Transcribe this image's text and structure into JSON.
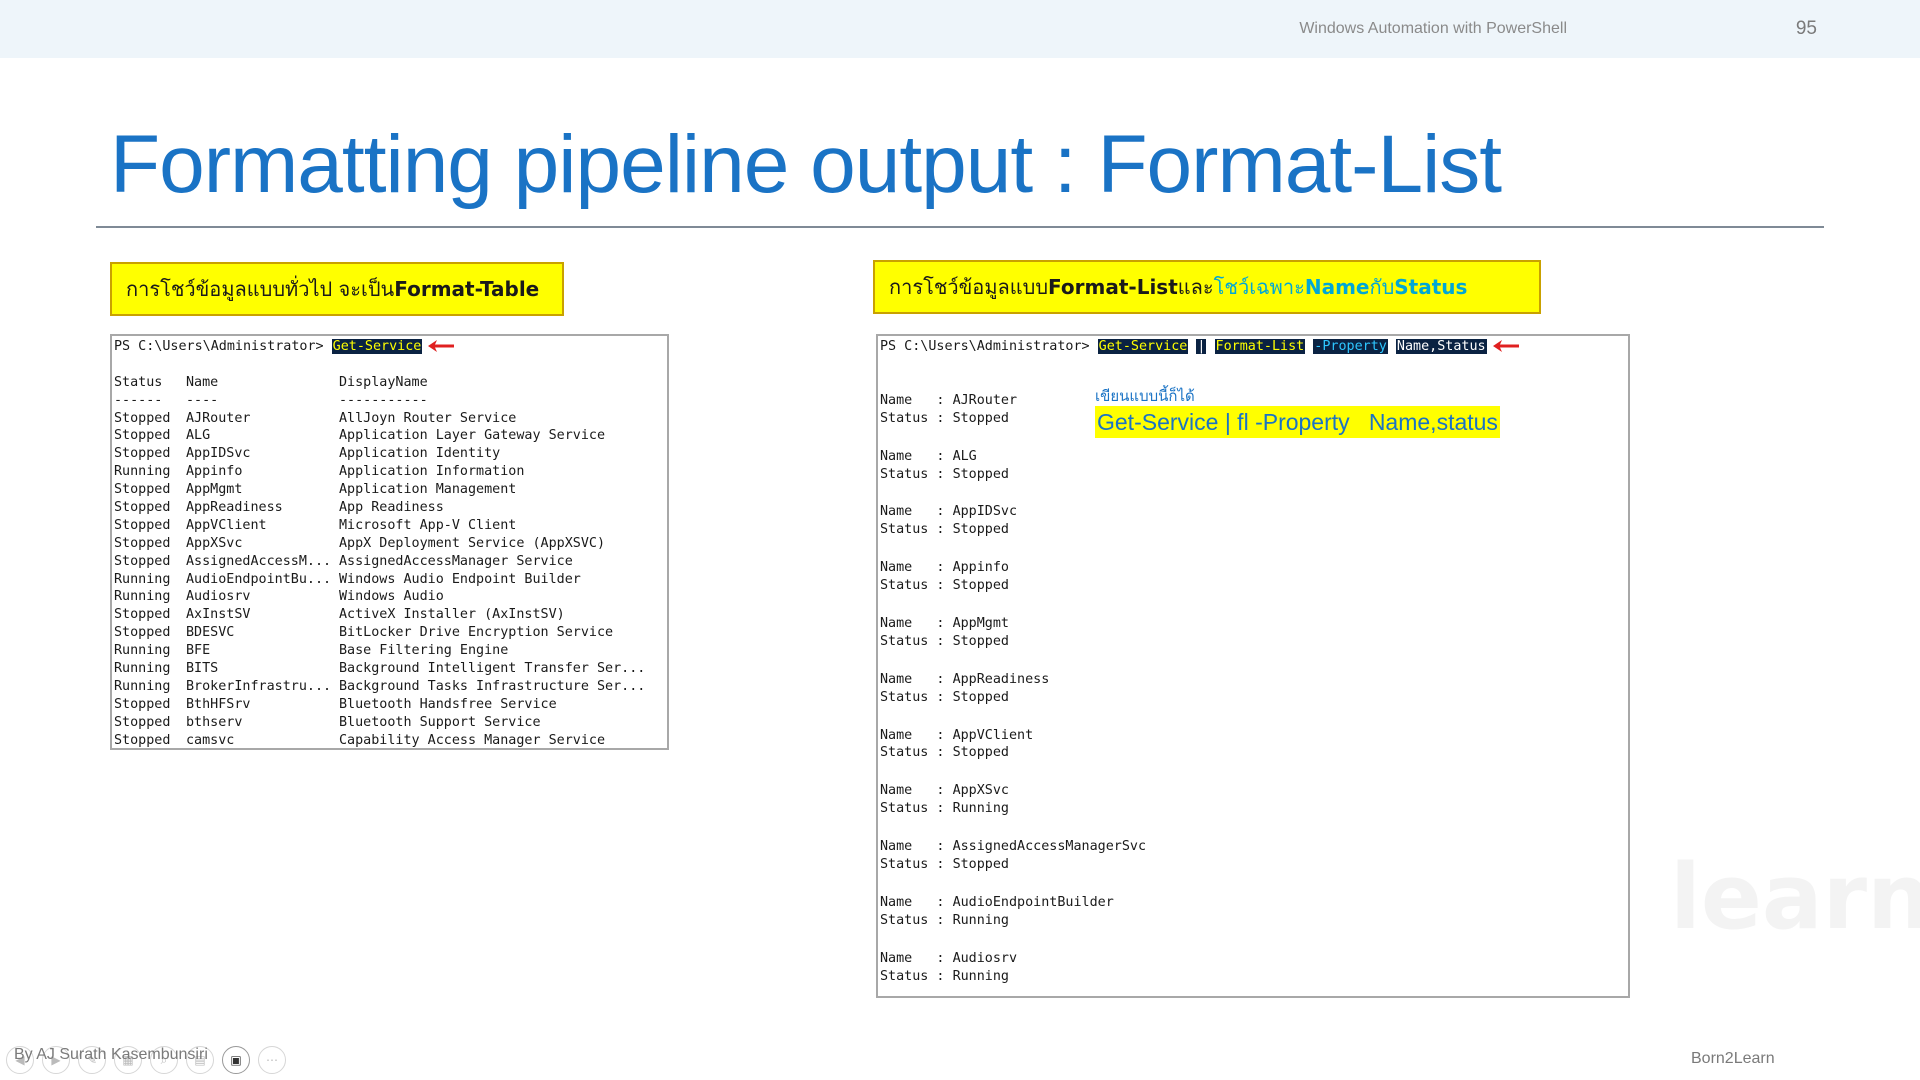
{
  "header": {
    "deck_title": "Windows Automation with PowerShell",
    "page_number": "95"
  },
  "slide": {
    "title": "Formatting pipeline output : Format-List"
  },
  "note_left": {
    "text_thai": "การโชว์ข้อมูลแบบทั่วไป จะเป็น ",
    "text_bold": "Format-Table"
  },
  "note_right": {
    "text_thai": "การโชว์ข้อมูลแบบ ",
    "text_bold": "Format-List",
    "text_mid": " และ",
    "text_cyan": "โชว์เฉพาะ ",
    "text_cyan_bold1": "Name",
    "text_cyan_mid": " กับ ",
    "text_cyan_bold2": "Status"
  },
  "console_left": {
    "prompt": "PS C:\\Users\\Administrator> ",
    "command": "Get-Service",
    "headers": [
      "Status",
      "Name",
      "DisplayName"
    ],
    "underlines": [
      "------",
      "----",
      "-----------"
    ],
    "rows": [
      [
        "Stopped",
        "AJRouter",
        "AllJoyn Router Service"
      ],
      [
        "Stopped",
        "ALG",
        "Application Layer Gateway Service"
      ],
      [
        "Stopped",
        "AppIDSvc",
        "Application Identity"
      ],
      [
        "Running",
        "Appinfo",
        "Application Information"
      ],
      [
        "Stopped",
        "AppMgmt",
        "Application Management"
      ],
      [
        "Stopped",
        "AppReadiness",
        "App Readiness"
      ],
      [
        "Stopped",
        "AppVClient",
        "Microsoft App-V Client"
      ],
      [
        "Stopped",
        "AppXSvc",
        "AppX Deployment Service (AppXSVC)"
      ],
      [
        "Stopped",
        "AssignedAccessM...",
        "AssignedAccessManager Service"
      ],
      [
        "Running",
        "AudioEndpointBu...",
        "Windows Audio Endpoint Builder"
      ],
      [
        "Running",
        "Audiosrv",
        "Windows Audio"
      ],
      [
        "Stopped",
        "AxInstSV",
        "ActiveX Installer (AxInstSV)"
      ],
      [
        "Stopped",
        "BDESVC",
        "BitLocker Drive Encryption Service"
      ],
      [
        "Running",
        "BFE",
        "Base Filtering Engine"
      ],
      [
        "Running",
        "BITS",
        "Background Intelligent Transfer Ser..."
      ],
      [
        "Running",
        "BrokerInfrastru...",
        "Background Tasks Infrastructure Ser..."
      ],
      [
        "Stopped",
        "BthHFSrv",
        "Bluetooth Handsfree Service"
      ],
      [
        "Stopped",
        "bthserv",
        "Bluetooth Support Service"
      ],
      [
        "Stopped",
        "camsvc",
        "Capability Access Manager Service"
      ]
    ]
  },
  "console_right": {
    "prompt": "PS C:\\Users\\Administrator> ",
    "cmd1": "Get-Service",
    "pipe": "|",
    "cmd2": "Format-List",
    "param": "-Property",
    "args": "Name,Status",
    "items": [
      {
        "name": "AJRouter",
        "status": "Stopped"
      },
      {
        "name": "ALG",
        "status": "Stopped"
      },
      {
        "name": "AppIDSvc",
        "status": "Stopped"
      },
      {
        "name": "Appinfo",
        "status": "Stopped"
      },
      {
        "name": "AppMgmt",
        "status": "Stopped"
      },
      {
        "name": "AppReadiness",
        "status": "Stopped"
      },
      {
        "name": "AppVClient",
        "status": "Stopped"
      },
      {
        "name": "AppXSvc",
        "status": "Running"
      },
      {
        "name": "AssignedAccessManagerSvc",
        "status": "Stopped"
      },
      {
        "name": "AudioEndpointBuilder",
        "status": "Running"
      },
      {
        "name": "Audiosrv",
        "status": "Running"
      }
    ]
  },
  "hint": {
    "small": "เขียนแบบนี้ก็ได้",
    "code": "Get-Service | fl -Property   Name,status"
  },
  "footer": {
    "author": "By AJ Surath Kasembunsiri",
    "brand": "Born2Learn",
    "watermark": "learn"
  },
  "colors": {
    "title_blue": "#1a73c5",
    "highlight_yellow": "#ffff00",
    "console_highlight_bg": "#0a2242",
    "arrow_red": "#e02020"
  }
}
